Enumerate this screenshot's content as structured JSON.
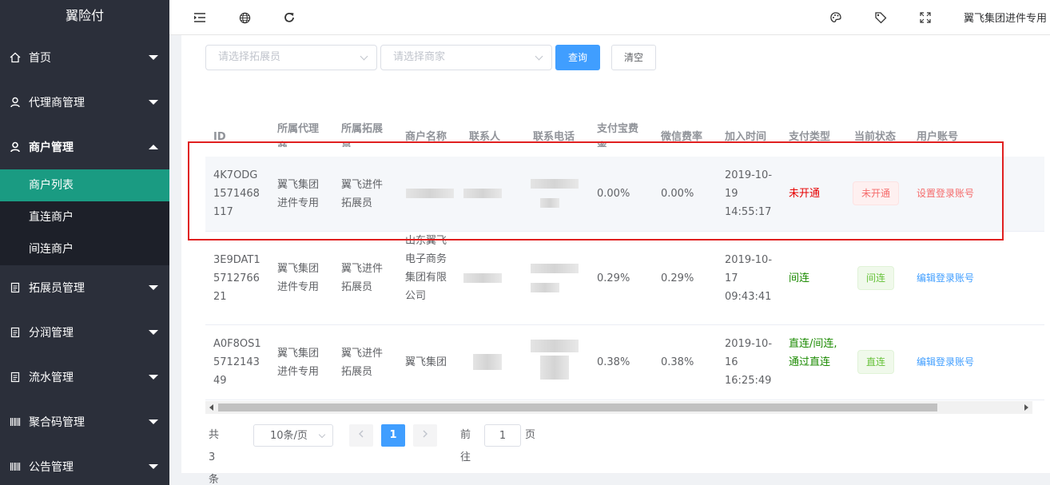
{
  "app": {
    "title": "翼险付"
  },
  "sidebar": {
    "items": [
      {
        "label": "首页",
        "icon": "home-icon"
      },
      {
        "label": "代理商管理",
        "icon": "user-icon"
      },
      {
        "label": "商户管理",
        "icon": "user-icon",
        "open": true,
        "children": [
          {
            "label": "商户列表",
            "active": true
          },
          {
            "label": "直连商户"
          },
          {
            "label": "间连商户"
          }
        ]
      },
      {
        "label": "拓展员管理",
        "icon": "clipboard-icon"
      },
      {
        "label": "分润管理",
        "icon": "clipboard-icon"
      },
      {
        "label": "流水管理",
        "icon": "clipboard-icon"
      },
      {
        "label": "聚合码管理",
        "icon": "qrcode-icon"
      },
      {
        "label": "公告管理",
        "icon": "qrcode-icon"
      }
    ]
  },
  "header": {
    "icons": [
      "indent-icon",
      "globe-icon",
      "refresh-icon",
      "palette-icon",
      "tag-icon",
      "fullscreen-icon"
    ],
    "user": "翼飞集团进件专用"
  },
  "filters": {
    "expander_placeholder": "请选择拓展员",
    "merchant_placeholder": "请选择商家",
    "query_label": "查询",
    "clear_label": "清空"
  },
  "table": {
    "headers": [
      "ID",
      "所属代理商",
      "所属拓展员",
      "商户名称",
      "联系人",
      "联系电话",
      "支付宝费率",
      "微信费率",
      "加入时间",
      "支付类型",
      "当前状态",
      "用户账号"
    ],
    "rows": [
      {
        "id": "4K7ODG1571468117",
        "agent": "翼飞集团进件专用",
        "expander": "拓展员",
        "expander_prefix": "翼飞进件",
        "name": "",
        "alipay_rate": "0.00%",
        "wechat_rate": "0.00%",
        "join_time": "2019-10-19 14:55:17",
        "pay_type": "未开通",
        "status": "未开通",
        "account_action": "设置登录账号"
      },
      {
        "id": "3E9DAT1571276621",
        "agent": "翼飞集团进件专用",
        "expander": "拓展员",
        "expander_prefix": "翼飞进件",
        "name": "山东翼飞电子商务集团有限公司",
        "alipay_rate": "0.29%",
        "wechat_rate": "0.29%",
        "join_time": "2019-10-17 09:43:41",
        "pay_type": "间连",
        "status": "间连",
        "account_action": "编辑登录账号"
      },
      {
        "id": "A0F8OS1571214349",
        "agent": "翼飞集团进件专用",
        "expander": "拓展员",
        "expander_prefix": "翼飞进件",
        "name": "翼飞集团",
        "alipay_rate": "0.38%",
        "wechat_rate": "0.38%",
        "join_time": "2019-10-16 16:25:49",
        "pay_type": "直连/间连,通过直连",
        "status": "直连",
        "account_action": "编辑登录账号"
      }
    ]
  },
  "pagination": {
    "total_text": "共 3 条",
    "page_size": "10条/页",
    "current_page": "1",
    "goto_label": "前往",
    "goto_value": "1",
    "page_suffix": "页"
  },
  "colors": {
    "sidebar_bg": "#2b2f3a",
    "active_item": "#1a9b82",
    "primary": "#409eff",
    "annotation": "#e02020"
  }
}
